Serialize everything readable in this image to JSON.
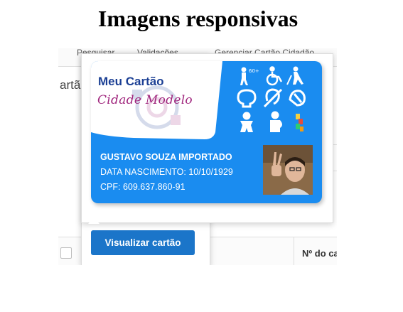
{
  "page": {
    "title": "Imagens responsivas"
  },
  "app": {
    "nav": [
      "Pesquisar",
      "Validações",
      "Gerenciar Cartão Cidadão"
    ],
    "heading_fragment": "artã",
    "snippet": "o",
    "table": {
      "column_header": "Nº do ca"
    }
  },
  "card": {
    "logo_line1": "Meu Cartão",
    "logo_line2": "Cidade Modelo",
    "name": "GUSTAVO SOUZA IMPORTADO",
    "birth": "DATA NASCIMENTO: 10/10/1929",
    "cpf": "CPF: 609.637.860-91",
    "colors": {
      "card_blue": "#1a8cf0",
      "logo_blue": "#1b3f94",
      "logo_magenta": "#a0267d",
      "button_blue": "#1b75c9"
    },
    "icons": [
      "elderly-icon",
      "wheelchair-icon",
      "blind-icon",
      "intellectual-disability-icon",
      "hearing-impaired-icon",
      "sign-language-icon",
      "child-icon",
      "pregnant-icon",
      "autism-icon"
    ]
  },
  "popover": {
    "button_label": "Visualizar cartão"
  }
}
